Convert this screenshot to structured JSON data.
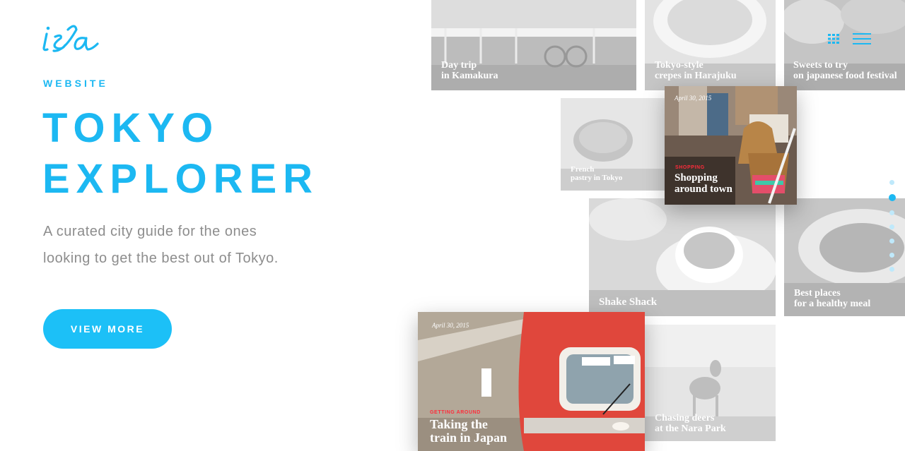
{
  "brand": {
    "logo_text": "isa"
  },
  "hero": {
    "eyebrow": "WEBSITE",
    "headline_line1": "TOKYO",
    "headline_line2": "EXPLORER",
    "lead_line1": "A curated city guide for the ones",
    "lead_line2": "looking to get the best out of Tokyo.",
    "cta_label": "VIEW MORE"
  },
  "nav": {
    "grid_icon": "grid-icon",
    "menu_icon": "hamburger-icon"
  },
  "cards": {
    "kamakura": {
      "line1": "Day trip",
      "line2": "in Kamakura"
    },
    "crepes": {
      "line1": "Tokyo-style",
      "line2": "crepes in Harajuku"
    },
    "sweets": {
      "line1": "Sweets to try",
      "line2": "on japanese food festival"
    },
    "pastry": {
      "line1": "French",
      "line2": "pastry in Tokyo"
    },
    "shopping": {
      "date": "April 30, 2015",
      "category": "SHOPPING",
      "line1": "Shopping",
      "line2": "around town"
    },
    "shake": {
      "line1": "Shake Shack"
    },
    "healthy": {
      "line1": "Best places",
      "line2": "for a healthy meal"
    },
    "train": {
      "date": "April 30, 2015",
      "category": "GETTING AROUND",
      "line1": "Taking the",
      "line2": "train in Japan"
    },
    "deers": {
      "line1": "Chasing deers",
      "line2": "at the Nara Park"
    }
  },
  "pagination": {
    "count": 7,
    "active_index": 1
  },
  "colors": {
    "accent": "#1cb8f2",
    "category_red": "#ff2b3a",
    "lead_text": "#8d8d8d"
  }
}
